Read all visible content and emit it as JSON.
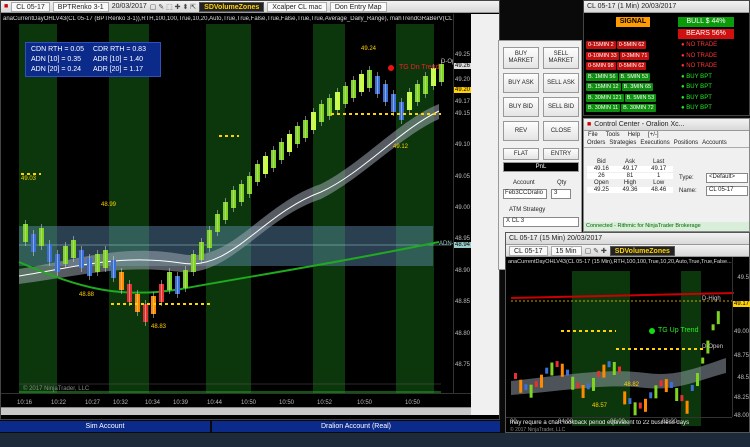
{
  "main_chart": {
    "title": "CL 05-17 - BPTRenko 3-1 20/03/2017",
    "instrument": "CL 05-17",
    "bar_type": "BPTRenko 3-1",
    "date": "20/03/2017",
    "sdv_label": "SDVolumeZones",
    "xcalper": "Xcalper CL mac",
    "entry_map": "Don Entry Map",
    "indicator_caption": "anaCurrentDayOHLV43(CL 05-17 (BPTRenko 3-1)),RTH,100,100,True,10,20,Auto,True,True,False,True,False,True,True,Average_Daily_Range), mahTrendGRaBerV(CL 05-1",
    "stats": [
      {
        "label": "CDN RTH = 0.05"
      },
      {
        "label": "CDR RTH = 0.83"
      },
      {
        "label": "ADN [10] = 0.35"
      },
      {
        "label": "ADR [10] = 1.40"
      },
      {
        "label": "ADN [20] = 0.24"
      },
      {
        "label": "ADR [20] = 1.17"
      }
    ],
    "prices": [
      "49.25",
      "49.20",
      "49.17",
      "49.15",
      "49.10",
      "49.05",
      "49.00",
      "48.95",
      "48.90",
      "48.85",
      "48.80",
      "48.75"
    ],
    "tags": {
      "top": "49.26",
      "mid": "49.20",
      "adn": "48.94"
    },
    "times": [
      "10:16",
      "10:22",
      "10:27",
      "10:32",
      "10:34",
      "10:39",
      "10:44",
      "10:50",
      "10:50",
      "10:52",
      "10:50",
      "10:50"
    ],
    "annotations": {
      "tg_dn": "TG Dn Trend",
      "d_open": "D-Open",
      "adn_low": "ADN-Low",
      "p_4924": "49.24",
      "p_4912": "49.12",
      "p_4903": "49.03",
      "p_4899": "48.99",
      "p_4888": "48.88",
      "p_4883": "48.83"
    },
    "copyright": "© 2017 NinjaTrader, LLC"
  },
  "order_panel": {
    "buy_market": "BUY MARKET",
    "sell_market": "SELL MARKET",
    "buy_ask": "BUY ASK",
    "sell_ask": "SELL ASK",
    "buy_bid": "BUY BID",
    "sell_bid": "SELL BID",
    "rev": "REV",
    "close": "CLOSE",
    "flat": "FLAT",
    "entry": "ENTRY",
    "pnl": "PnL",
    "account_label": "Account",
    "qty_label": "Qty",
    "account_value": "Feb3CCDralio",
    "qty_value": "3",
    "atm_label": "ATM Strategy",
    "atm_value": "X CL 3"
  },
  "signal_panel": {
    "title": "CL 05-17 (1 Min) 20/03/2017",
    "signal": "SIGNAL",
    "bull": "BULL $ 44%",
    "bears": "BEARS 56%",
    "rows": [
      {
        "left": "0-15MIN 2",
        "right": "0-5MIN 62",
        "status": "NO TRADE",
        "cls": "r"
      },
      {
        "left": "0-10MIN 33",
        "right": "0-3MIN 71",
        "status": "NO TRADE",
        "cls": "r"
      },
      {
        "left": "0-5MIN 98",
        "right": "0-5MIN 62",
        "status": "NO TRADE",
        "cls": "r"
      },
      {
        "left": "B. 1MIN 56",
        "right": "B. 5MIN 53",
        "status": "BUY BPT",
        "cls": "g"
      },
      {
        "left": "B. 15MIN 12",
        "right": "B. 3MIN 65",
        "status": "BUY BPT",
        "cls": "g"
      },
      {
        "left": "B. 30MIN 121",
        "right": "B. 5MIN 53",
        "status": "BUY BPT",
        "cls": "g"
      },
      {
        "left": "B. 30MIN 11",
        "right": "B. 30MIN 72",
        "status": "BUY BPT",
        "cls": "g"
      }
    ]
  },
  "control_center": {
    "title": "Control Center - Oralion Xc...",
    "menu": [
      "File",
      "Tools",
      "Help",
      "[+/-]"
    ],
    "tabs": [
      "Orders",
      "Strategies",
      "Executions",
      "Positions",
      "Accounts"
    ],
    "headers": [
      "Bid",
      "Ask",
      "Last"
    ],
    "row1": [
      "49.16",
      "49.17",
      "49.17"
    ],
    "row2": [
      "26",
      "81",
      "1"
    ],
    "headers2": [
      "Open",
      "High",
      "Low"
    ],
    "row3": [
      "49.25",
      "49.36",
      "48.46"
    ],
    "type_label": "Type:",
    "type_value": "<Default>",
    "name_label": "Name:",
    "name_value": "CL 05-17",
    "status": "Connected - Rithmic for NinjaTrader Brokerage"
  },
  "chart15": {
    "title": "CL 05-17 (15 Min) 20/03/2017",
    "instrument": "CL 05-17",
    "interval": "15 Min",
    "sdv_label": "SDVolumeZones",
    "caption": "anaCurrentDayOHLV43(CL 05-17 (15 Min),RTH,100,100,True,10,20,Auto,True,True,False...",
    "tg_up": "TG Up Trend",
    "d_high": "D-High",
    "d_open": "D-Open",
    "prices": [
      "49.5",
      "49.17",
      "49.00",
      "48.75",
      "48.5",
      "48.25",
      "48.00"
    ],
    "times": [
      "00",
      "04:00",
      "06:00",
      "08:00"
    ],
    "p_4882": "48.82",
    "p_4857": "48.57",
    "footer_note": "may require a chart lookback period equivalent to 22 business days",
    "copyright": "© 2017 NinjaTrader, LLC"
  },
  "footer": {
    "sim": "Sim Account",
    "dralion": "Dralion Account (Real)"
  }
}
